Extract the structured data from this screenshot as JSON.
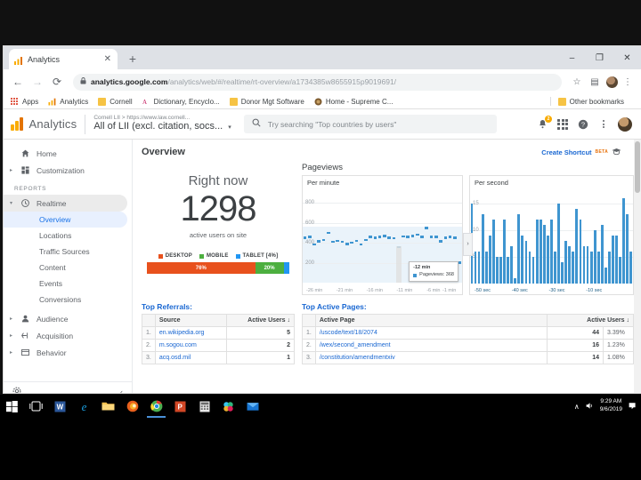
{
  "browser": {
    "tab": {
      "title": "Analytics",
      "favicon": "analytics-bars-icon",
      "close": "✕"
    },
    "new_tab": "+",
    "window_controls": {
      "minimize": "–",
      "maximize": "❐",
      "close": "✕"
    },
    "nav": {
      "back": "←",
      "forward": "→",
      "reload": "⟳"
    },
    "omnibox": {
      "lock": "🔒",
      "url_domain": "analytics.google.com",
      "url_path": "/analytics/web/#/realtime/rt-overview/a1734385w8655915p9019691/"
    },
    "toolbar_icons": {
      "star": "☆",
      "extension": "▤",
      "menu": "⋮"
    },
    "bookmarks": [
      {
        "label": "Apps",
        "icon": "apps-grid-icon"
      },
      {
        "label": "Analytics",
        "icon": "analytics-bars-icon"
      },
      {
        "label": "Cornell",
        "icon": "folder-icon"
      },
      {
        "label": "Dictionary, Encyclo...",
        "icon": "dictionary-icon"
      },
      {
        "label": "Donor Mgt Software",
        "icon": "folder-icon"
      },
      {
        "label": "Home - Supreme C...",
        "icon": "seal-icon"
      }
    ],
    "other_bookmarks": {
      "label": "Other bookmarks",
      "icon": "folder-icon"
    }
  },
  "ga_header": {
    "brand": "Analytics",
    "account_crumb": "Cornell LII  >  https://www.law.cornell...",
    "property_name": "All of LII (excl. citation, socs...",
    "property_caret": "▾",
    "search_placeholder": "Try searching \"Top countries by users\"",
    "search_icon": "search-icon",
    "notifications_count": "2",
    "help_icon": "?",
    "apps_icon": "apps-grid-icon",
    "more_icon": "⋮"
  },
  "sidebar": {
    "items": [
      {
        "label": "Home",
        "icon": "home-icon",
        "arrow": ""
      },
      {
        "label": "Customization",
        "icon": "customization-icon",
        "arrow": "▸"
      }
    ],
    "section_label": "REPORTS",
    "realtime": {
      "label": "Realtime",
      "icon": "clock-icon",
      "arrow": "▾",
      "children": [
        "Overview",
        "Locations",
        "Traffic Sources",
        "Content",
        "Events",
        "Conversions"
      ],
      "active_child": "Overview"
    },
    "bottom_items": [
      {
        "label": "Audience",
        "icon": "person-icon",
        "arrow": "▸"
      },
      {
        "label": "Acquisition",
        "icon": "acquisition-icon",
        "arrow": "▸"
      },
      {
        "label": "Behavior",
        "icon": "behavior-icon",
        "arrow": "▸"
      }
    ],
    "footer": {
      "settings_icon": "gear-icon",
      "collapse_icon": "‹"
    }
  },
  "main": {
    "page_title": "Overview",
    "create_shortcut": {
      "label": "Create Shortcut",
      "badge": "BETA",
      "icon": "graduation-cap-icon"
    },
    "right_now": {
      "title": "Right now",
      "value": "1298",
      "subtitle": "active users on site",
      "legend": [
        {
          "label": "DESKTOP",
          "color": "#e8511d"
        },
        {
          "label": "MOBILE",
          "color": "#4caf3f"
        },
        {
          "label": "TABLET [4%]",
          "color": "#2196f3"
        }
      ],
      "segments": [
        {
          "label": "76%",
          "pct": 76,
          "color": "#e8511d"
        },
        {
          "label": "20%",
          "pct": 20,
          "color": "#4caf3f"
        },
        {
          "label": "",
          "pct": 4,
          "color": "#2196f3"
        }
      ]
    },
    "pageviews": {
      "title": "Pageviews",
      "per_minute_label": "Per minute",
      "per_second_label": "Per second",
      "expand_icon": "›",
      "tooltip": {
        "time": "-12 min",
        "metric_label": "Pageviews:",
        "metric_value": "368"
      }
    },
    "top_referrals": {
      "title": "Top Referrals:",
      "columns": [
        "Source",
        "Active Users ↓"
      ],
      "rows": [
        {
          "index": "1.",
          "source": "en.wikipedia.org",
          "users": "5"
        },
        {
          "index": "2.",
          "source": "m.sogou.com",
          "users": "2"
        },
        {
          "index": "3.",
          "source": "acq.osd.mil",
          "users": "1"
        }
      ]
    },
    "top_active_pages": {
      "title": "Top Active Pages:",
      "columns": [
        "Active Page",
        "Active Users ↓",
        ""
      ],
      "rows": [
        {
          "index": "1.",
          "page": "/uscode/text/18/2074",
          "users": "44",
          "pct": "3.39%"
        },
        {
          "index": "2.",
          "page": "/wex/second_amendment",
          "users": "16",
          "pct": "1.23%"
        },
        {
          "index": "3.",
          "page": "/constitution/amendmentxiv",
          "users": "14",
          "pct": "1.08%"
        }
      ]
    }
  },
  "chart_data": [
    {
      "type": "bar",
      "title": "Pageviews Per minute",
      "xlabel": "",
      "ylabel": "",
      "ylim": [
        0,
        900
      ],
      "yticks": [
        200,
        400,
        600,
        800
      ],
      "xticks": [
        "-26 min",
        "-21 min",
        "-16 min",
        "-11 min",
        "-6 min",
        "-1 min"
      ],
      "grid": true,
      "highlight": {
        "x": "-12 min",
        "value": 368
      },
      "values": [
        462,
        470,
        396,
        425,
        440,
        508,
        418,
        430,
        420,
        400,
        412,
        428,
        392,
        440,
        468,
        462,
        470,
        480,
        462,
        455,
        368,
        472,
        470,
        478,
        492,
        470,
        560,
        470,
        468,
        425,
        462,
        470,
        462,
        210
      ]
    },
    {
      "type": "bar",
      "title": "Pageviews Per second",
      "xlabel": "",
      "ylabel": "",
      "ylim": [
        0,
        17
      ],
      "yticks": [
        5,
        10,
        15
      ],
      "xticks": [
        "-50 sec",
        "-40 sec",
        "-30 sec",
        "-10 sec"
      ],
      "grid": true,
      "values": [
        15,
        6,
        6,
        13,
        6,
        9,
        12,
        5,
        5,
        12,
        5,
        7,
        1,
        13,
        9,
        8,
        6,
        5,
        12,
        12,
        11,
        9,
        12,
        6,
        15,
        4,
        8,
        7,
        6,
        14,
        12,
        7,
        7,
        6,
        10,
        6,
        11,
        3,
        6,
        9,
        9,
        5,
        16,
        13,
        6
      ]
    }
  ],
  "taskbar": {
    "items": [
      {
        "name": "start-button",
        "icon": "windows-icon"
      },
      {
        "name": "task-view-button",
        "icon": "task-view-icon"
      },
      {
        "name": "word-app",
        "icon": "word-icon"
      },
      {
        "name": "internet-explorer-app",
        "icon": "ie-icon"
      },
      {
        "name": "file-explorer-app",
        "icon": "folder-icon"
      },
      {
        "name": "firefox-app",
        "icon": "firefox-icon"
      },
      {
        "name": "chrome-app",
        "icon": "chrome-icon"
      },
      {
        "name": "powerpoint-app",
        "icon": "powerpoint-icon"
      },
      {
        "name": "calculator-app",
        "icon": "calculator-icon"
      },
      {
        "name": "slack-app",
        "icon": "slack-icon"
      },
      {
        "name": "mail-app",
        "icon": "mail-icon"
      }
    ],
    "tray": {
      "chevron": "∧",
      "volume": "🔊",
      "time": "9:29 AM",
      "date": "9/6/2019",
      "action_center": "❐"
    }
  }
}
